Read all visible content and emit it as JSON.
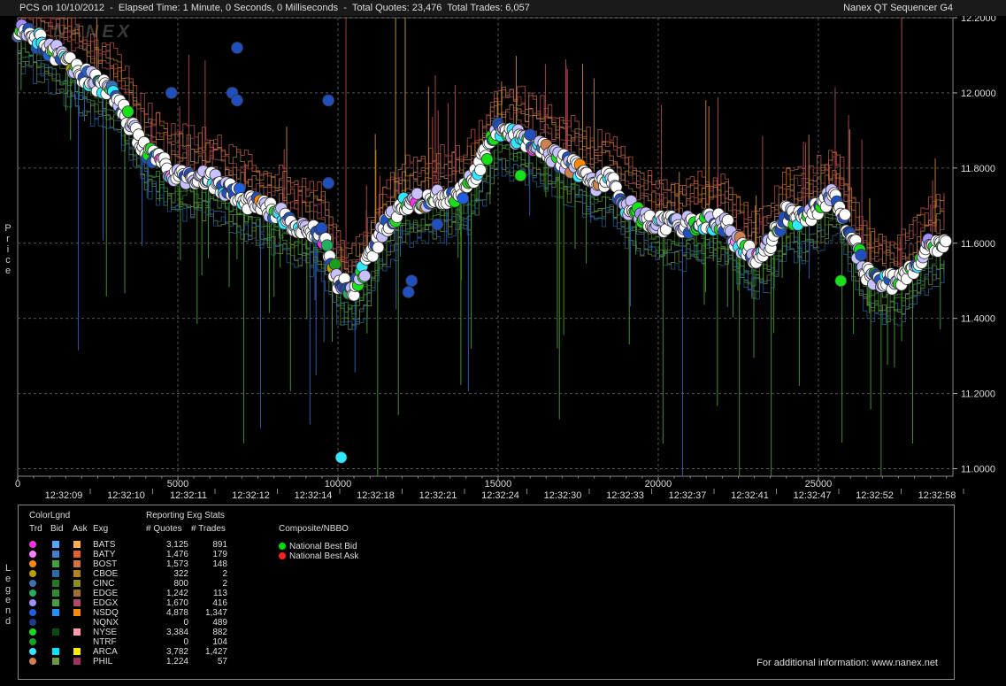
{
  "header": {
    "left": "PCS on 10/10/2012  -  Elapsed Time: 1 Minute, 0 Seconds, 0 Milliseconds  -  Total Quotes: 23,476  Total Trades: 6,057",
    "right": "Nanex QT Sequencer G4",
    "watermark": "NANEX"
  },
  "side_labels": {
    "price": "Price",
    "legend": "Legend"
  },
  "chart_data": {
    "type": "scatter",
    "ylabel": "Price",
    "xlim": [
      0,
      29200
    ],
    "ylim": [
      10.98,
      12.2
    ],
    "grid": true,
    "y_ticks": [
      "12.2000",
      "12.0000",
      "11.8000",
      "11.6000",
      "11.4000",
      "11.2000",
      "11.0000"
    ],
    "x_ticks": [
      "0",
      "5000",
      "10000",
      "15000",
      "20000",
      "25000"
    ],
    "time_labels": [
      "12:32:09",
      "12:32:10",
      "12:32:11",
      "12:32:12",
      "12:32:14",
      "12:32:18",
      "12:32:21",
      "12:32:24",
      "12:32:30",
      "12:32:33",
      "12:32:37",
      "12:32:41",
      "12:32:47",
      "12:32:52",
      "12:32:58"
    ],
    "trade_price_path": [
      [
        0,
        12.17
      ],
      [
        1000,
        12.12
      ],
      [
        2000,
        12.05
      ],
      [
        3000,
        12.0
      ],
      [
        4000,
        11.84
      ],
      [
        5000,
        11.78
      ],
      [
        6000,
        11.77
      ],
      [
        7000,
        11.72
      ],
      [
        8000,
        11.68
      ],
      [
        9000,
        11.64
      ],
      [
        9500,
        11.62
      ],
      [
        10000,
        11.5
      ],
      [
        10500,
        11.47
      ],
      [
        11000,
        11.56
      ],
      [
        11500,
        11.65
      ],
      [
        12000,
        11.7
      ],
      [
        13000,
        11.72
      ],
      [
        14000,
        11.74
      ],
      [
        14500,
        11.82
      ],
      [
        15000,
        11.9
      ],
      [
        16000,
        11.87
      ],
      [
        17000,
        11.82
      ],
      [
        17500,
        11.8
      ],
      [
        18000,
        11.76
      ],
      [
        18500,
        11.77
      ],
      [
        19000,
        11.7
      ],
      [
        20000,
        11.65
      ],
      [
        21000,
        11.65
      ],
      [
        22000,
        11.66
      ],
      [
        22500,
        11.6
      ],
      [
        23000,
        11.56
      ],
      [
        23500,
        11.6
      ],
      [
        24000,
        11.68
      ],
      [
        24500,
        11.66
      ],
      [
        25000,
        11.7
      ],
      [
        25500,
        11.73
      ],
      [
        26000,
        11.62
      ],
      [
        26500,
        11.52
      ],
      [
        27000,
        11.5
      ],
      [
        27500,
        11.5
      ],
      [
        28000,
        11.54
      ],
      [
        28500,
        11.6
      ],
      [
        29000,
        11.6
      ]
    ],
    "outlier_trades": [
      [
        6850,
        12.12
      ],
      [
        4800,
        12.0
      ],
      [
        6700,
        12.0
      ],
      [
        6850,
        11.98
      ],
      [
        9700,
        11.98
      ],
      [
        9700,
        11.76
      ],
      [
        12200,
        11.47
      ],
      [
        10100,
        11.03
      ],
      [
        12300,
        11.5
      ],
      [
        13100,
        11.65
      ],
      [
        15700,
        11.78
      ],
      [
        25700,
        11.5
      ]
    ]
  },
  "legend": {
    "color_legend_title": "ColorLgnd",
    "stats_title": "Reporting Exg Stats",
    "composite_title": "Composite/NBBO",
    "col_trd": "Trd",
    "col_bid": "Bid",
    "col_ask": "Ask",
    "col_exg": "Exg",
    "col_quotes": "# Quotes",
    "col_trades": "# Trades",
    "exchanges": [
      {
        "name": "BATS",
        "quotes": "3,125",
        "trades": "891",
        "trd": "#ff2ee8",
        "bid": "#4fa8ff",
        "ask": "#ffb040"
      },
      {
        "name": "BATY",
        "quotes": "1,476",
        "trades": "179",
        "trd": "#ff80ff",
        "bid": "#3c7fd0",
        "ask": "#e0602a"
      },
      {
        "name": "BOST",
        "quotes": "1,573",
        "trades": "148",
        "trd": "#ff8800",
        "bid": "#3aa33a",
        "ask": "#d87040"
      },
      {
        "name": "CBOE",
        "quotes": "322",
        "trades": "2",
        "trd": "#b8a000",
        "bid": "#2c6aa8",
        "ask": "#b0841c"
      },
      {
        "name": "CINC",
        "quotes": "800",
        "trades": "2",
        "trd": "#3a70b8",
        "bid": "#1f7a1f",
        "ask": "#8c8c1c"
      },
      {
        "name": "EDGE",
        "quotes": "1,242",
        "trades": "113",
        "trd": "#20b060",
        "bid": "#2a8f2a",
        "ask": "#a07030"
      },
      {
        "name": "EDGX",
        "quotes": "1,670",
        "trades": "416",
        "trd": "#a090ff",
        "bid": "#40a040",
        "ask": "#b04a64"
      },
      {
        "name": "NSDQ",
        "quotes": "4,878",
        "trades": "1,347",
        "trd": "#2060e0",
        "bid": "#1e90ff",
        "ask": "#ff8c00"
      },
      {
        "name": "NQNX",
        "quotes": "0",
        "trades": "489",
        "trd": "#1c3c8c",
        "bid": "",
        "ask": ""
      },
      {
        "name": "NYSE",
        "quotes": "3,384",
        "trades": "882",
        "trd": "#18e018",
        "bid": "#0c4a0c",
        "ask": "#ff9aa8"
      },
      {
        "name": "NTRF",
        "quotes": "0",
        "trades": "104",
        "trd": "#1aa01a",
        "bid": "",
        "ask": ""
      },
      {
        "name": "ARCA",
        "quotes": "3,782",
        "trades": "1,427",
        "trd": "#30e8ff",
        "bid": "#00e5ff",
        "ask": "#ffee00"
      },
      {
        "name": "PHIL",
        "quotes": "1,224",
        "trades": "57",
        "trd": "#d08050",
        "bid": "#6a9a3a",
        "ask": "#a03060"
      }
    ],
    "composite": [
      {
        "label": "National Best Bid",
        "color": "#00e000"
      },
      {
        "label": "National Best Ask",
        "color": "#ff2020"
      }
    ],
    "footer": "For additional information: www.nanex.net"
  }
}
